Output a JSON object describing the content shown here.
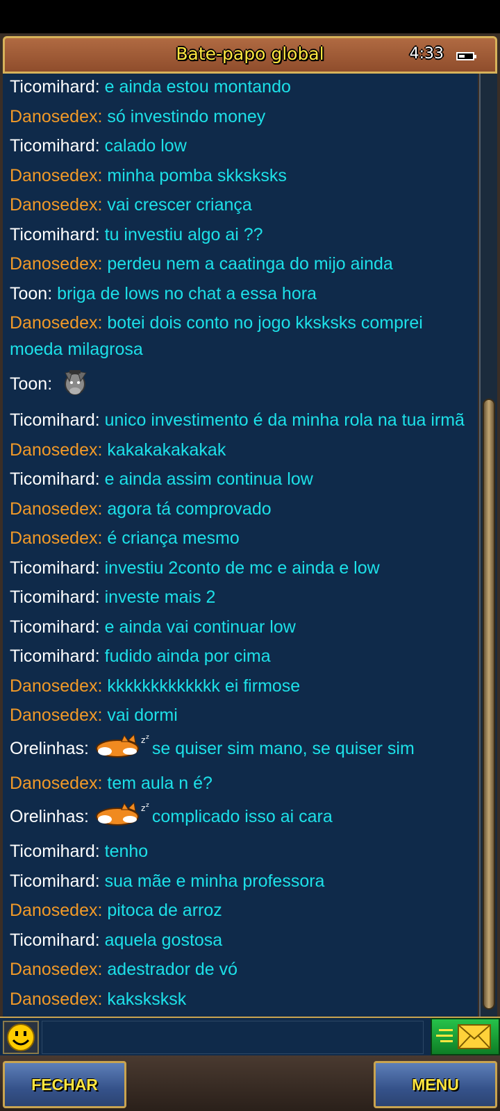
{
  "header": {
    "title": "Bate-papo global",
    "clock": "4:33"
  },
  "messages": [
    {
      "name": "Ticomihard:",
      "text": "e ainda estou montando",
      "color": "white"
    },
    {
      "name": "Danosedex:",
      "text": "só investindo money",
      "color": "orange"
    },
    {
      "name": "Ticomihard:",
      "text": "calado low",
      "color": "white"
    },
    {
      "name": "Danosedex:",
      "text": "minha pomba skksksks",
      "color": "orange"
    },
    {
      "name": "Danosedex:",
      "text": "vai crescer criança",
      "color": "orange"
    },
    {
      "name": "Ticomihard:",
      "text": "tu investiu algo ai ??",
      "color": "white"
    },
    {
      "name": "Danosedex:",
      "text": "perdeu nem a caatinga do mijo ainda",
      "color": "orange"
    },
    {
      "name": "Toon:",
      "text": "briga de lows no chat a essa hora",
      "color": "white"
    },
    {
      "name": "Danosedex:",
      "text": "botei dois conto no jogo kksksks comprei moeda milagrosa",
      "color": "orange"
    },
    {
      "name": "Toon:",
      "text": "",
      "color": "white",
      "emote": "donkey-emote"
    },
    {
      "name": "Ticomihard:",
      "text": "unico investimento é da minha rola na tua irmã",
      "color": "white"
    },
    {
      "name": "Danosedex:",
      "text": "kakakakakakak",
      "color": "orange"
    },
    {
      "name": "Ticomihard:",
      "text": "e ainda assim continua low",
      "color": "white"
    },
    {
      "name": "Danosedex:",
      "text": "agora tá comprovado",
      "color": "orange"
    },
    {
      "name": "Danosedex:",
      "text": "é criança mesmo",
      "color": "orange"
    },
    {
      "name": "Ticomihard:",
      "text": "investiu 2conto de mc e ainda e low",
      "color": "white"
    },
    {
      "name": "Ticomihard:",
      "text": "investe mais 2",
      "color": "white"
    },
    {
      "name": "Ticomihard:",
      "text": "e ainda vai continuar low",
      "color": "white"
    },
    {
      "name": "Ticomihard:",
      "text": "fudido ainda por cima",
      "color": "white"
    },
    {
      "name": "Danosedex:",
      "text": "kkkkkkkkkkkkk ei firmose",
      "color": "orange"
    },
    {
      "name": "Danosedex:",
      "text": "vai dormi",
      "color": "orange"
    },
    {
      "name": "Orelinhas:",
      "text": "se quiser sim mano, se quiser sim",
      "color": "white",
      "emote": "sleeping-fox-emote"
    },
    {
      "name": "Danosedex:",
      "text": "tem aula n é?",
      "color": "orange"
    },
    {
      "name": "Orelinhas:",
      "text": "complicado isso ai cara",
      "color": "white",
      "emote": "sleeping-fox-emote"
    },
    {
      "name": "Ticomihard:",
      "text": "tenho",
      "color": "white"
    },
    {
      "name": "Ticomihard:",
      "text": "sua mãe e minha professora",
      "color": "white"
    },
    {
      "name": "Danosedex:",
      "text": "pitoca de arroz",
      "color": "orange"
    },
    {
      "name": "Ticomihard:",
      "text": "aquela gostosa",
      "color": "white"
    },
    {
      "name": "Danosedex:",
      "text": "adestrador de vó",
      "color": "orange"
    },
    {
      "name": "Danosedex:",
      "text": "kaksksksk",
      "color": "orange"
    }
  ],
  "input": {
    "placeholder": "",
    "value": ""
  },
  "buttons": {
    "close": "FECHAR",
    "menu": "MENU"
  },
  "icons": {
    "emoji": "smiley-icon",
    "send": "envelope-send-icon",
    "battery": "battery-icon"
  },
  "colors": {
    "background": "#0f2a4a",
    "message": "#1de0e8",
    "orange_name": "#f29a28",
    "title": "#ffe640"
  },
  "scrollbar": {
    "position": 1.0
  }
}
